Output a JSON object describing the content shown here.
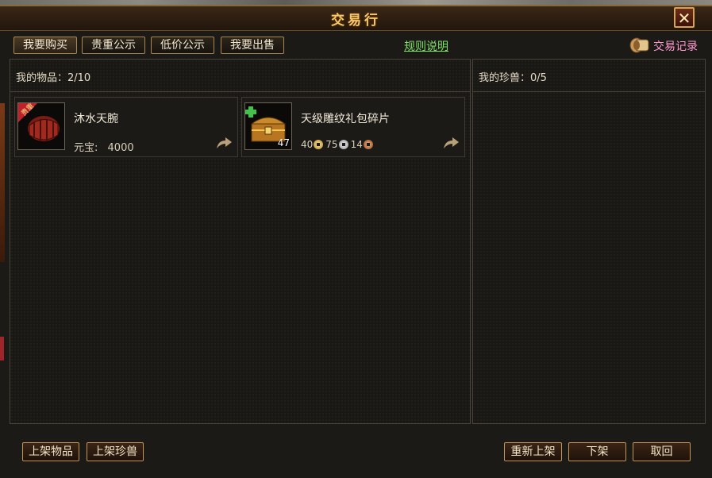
{
  "window": {
    "title": "交易行",
    "close_label": "✕"
  },
  "tabs": [
    {
      "label": "我要购买"
    },
    {
      "label": "贵重公示"
    },
    {
      "label": "低价公示"
    },
    {
      "label": "我要出售"
    }
  ],
  "rules_link": "规则说明",
  "records_label": "交易记录",
  "items_panel": {
    "header": "我的物品：2/10",
    "items": [
      {
        "name": "沐水天腕",
        "price_label": "元宝:",
        "price_value": "4000",
        "icon": "bracer-icon"
      },
      {
        "name": "天级雕纹礼包碎片",
        "count": "47",
        "icon": "treasure-chest-icon",
        "gold": "40",
        "silver": "75",
        "copper": "14"
      }
    ]
  },
  "pets_panel": {
    "header": "我的珍兽：0/5"
  },
  "buttons": {
    "list_item": "上架物品",
    "list_pet": "上架珍兽",
    "relist": "重新上架",
    "delist": "下架",
    "cancel": "取回"
  },
  "colors": {
    "accent": "#f3c96b",
    "link": "#7fe06a",
    "records": "#ff9ad0"
  }
}
